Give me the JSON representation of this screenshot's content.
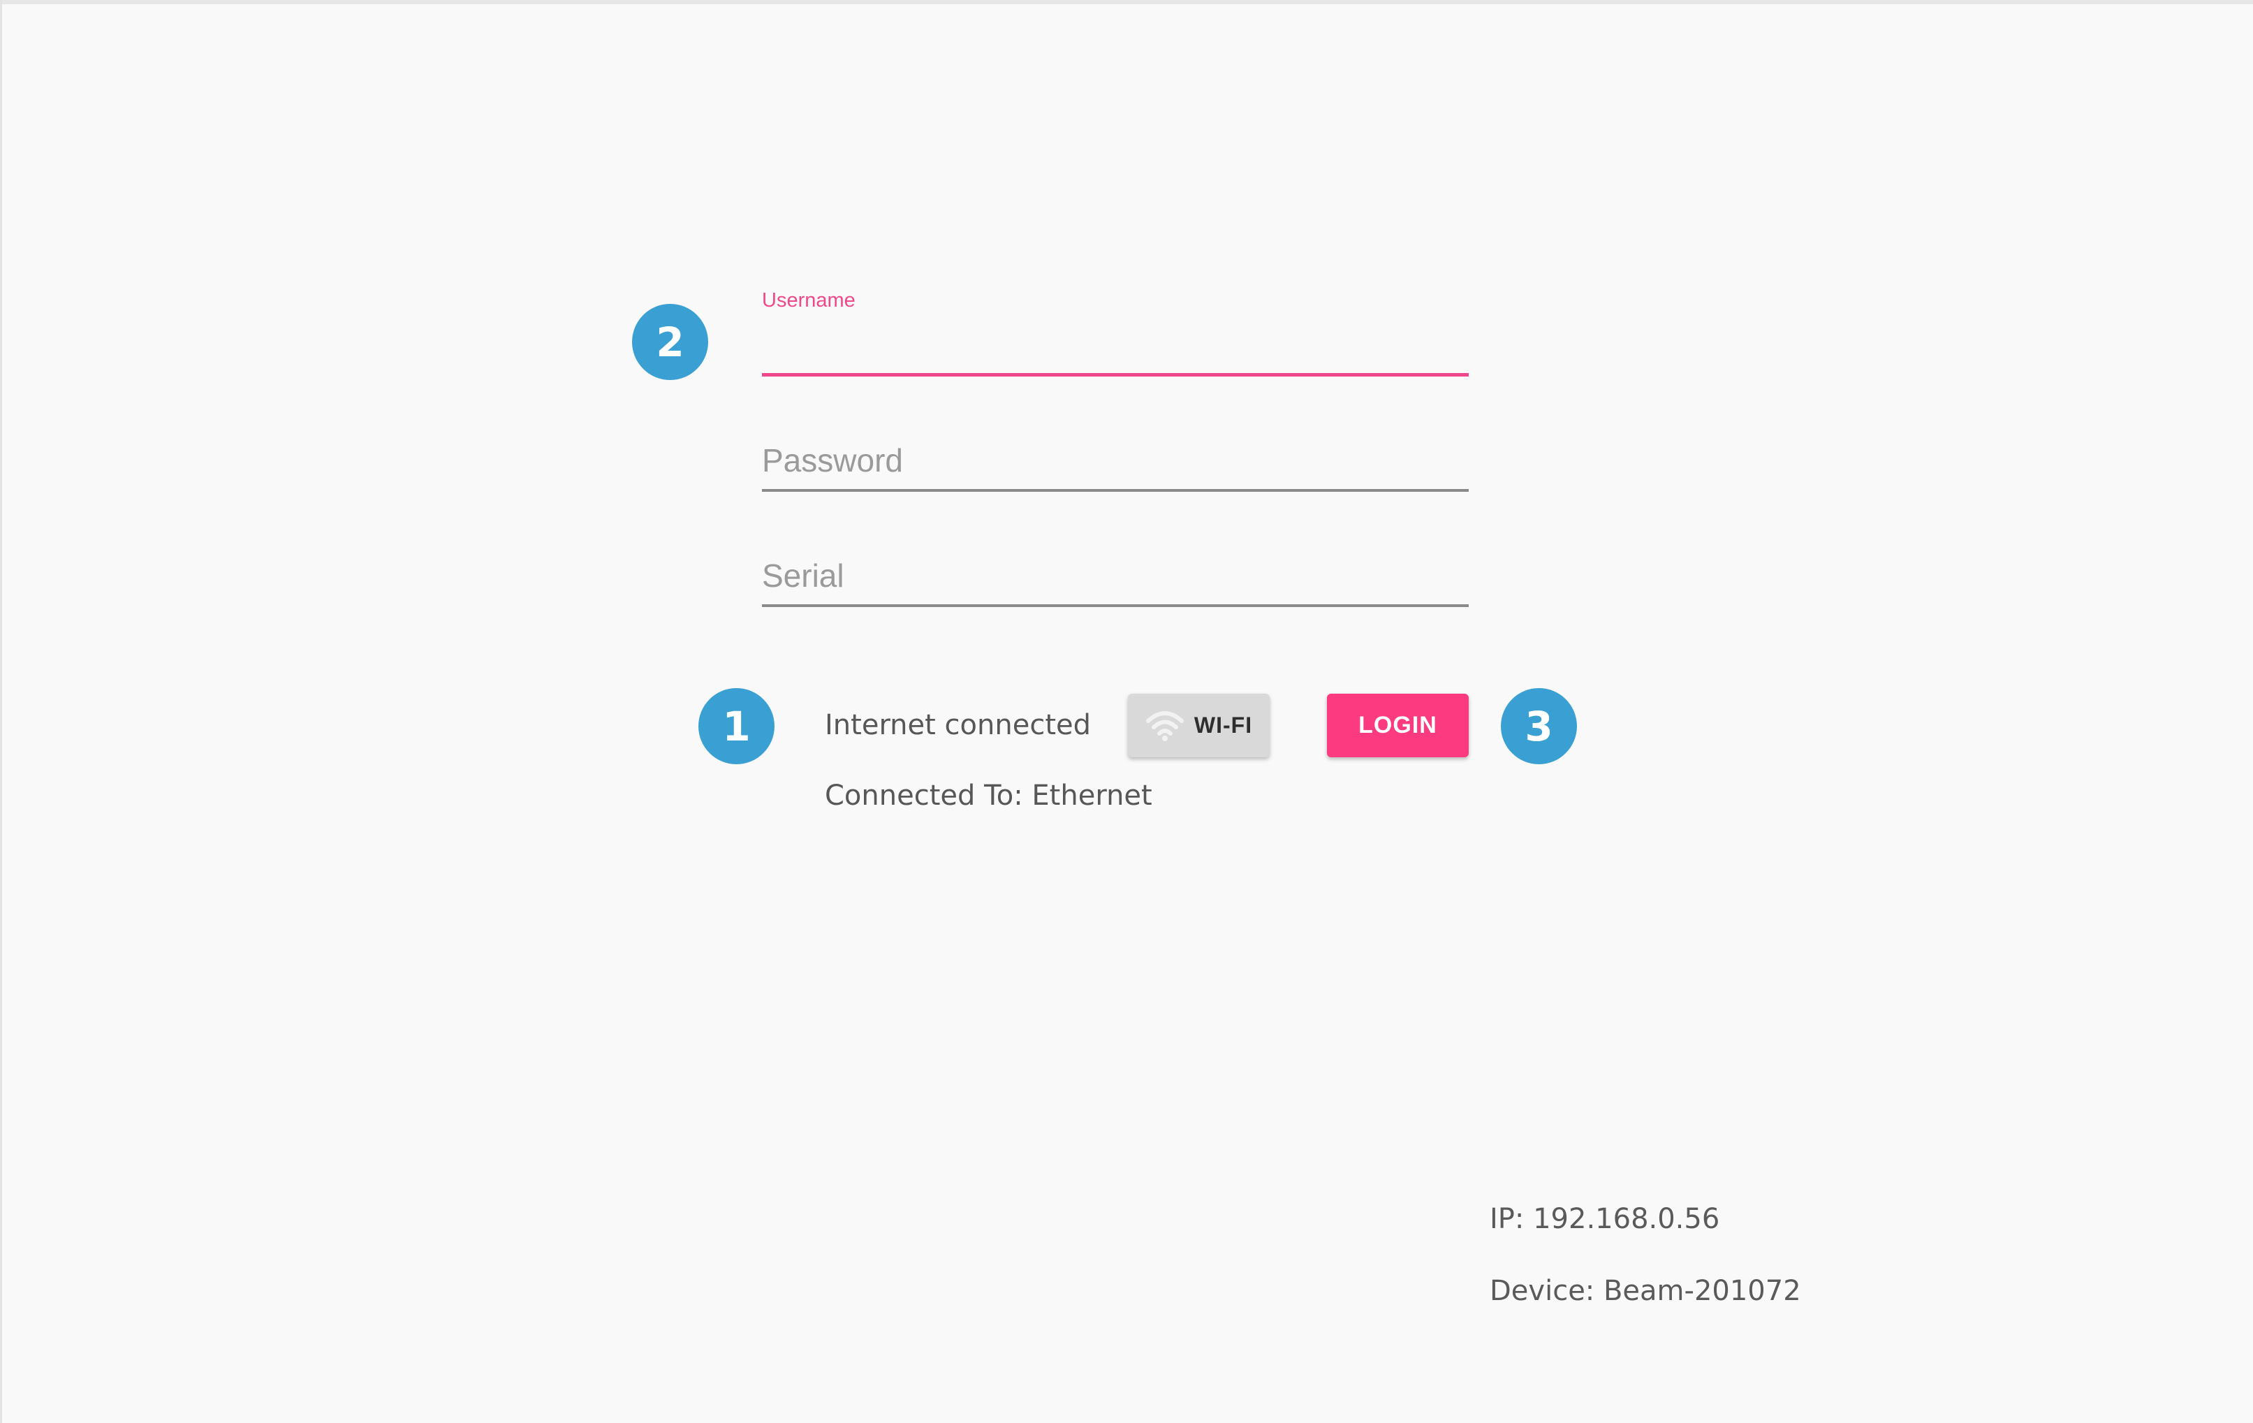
{
  "form": {
    "username": {
      "label": "Username",
      "value": ""
    },
    "password": {
      "label": "Password",
      "value": ""
    },
    "serial": {
      "label": "Serial",
      "value": ""
    }
  },
  "status": {
    "internet": "Internet connected",
    "connected_to": "Connected To: Ethernet"
  },
  "buttons": {
    "wifi_label": "WI-FI",
    "wifi_icon": "wifi-icon",
    "login_label": "LOGIN"
  },
  "device": {
    "ip": "IP: 192.168.0.56",
    "name": "Device: Beam-201072"
  },
  "markers": [
    "1",
    "2",
    "3"
  ],
  "colors": {
    "accent": "#fb3a7f",
    "focus_label": "#ee4a8b",
    "marker": "#3aa0d3",
    "background": "#f9f9f9"
  }
}
